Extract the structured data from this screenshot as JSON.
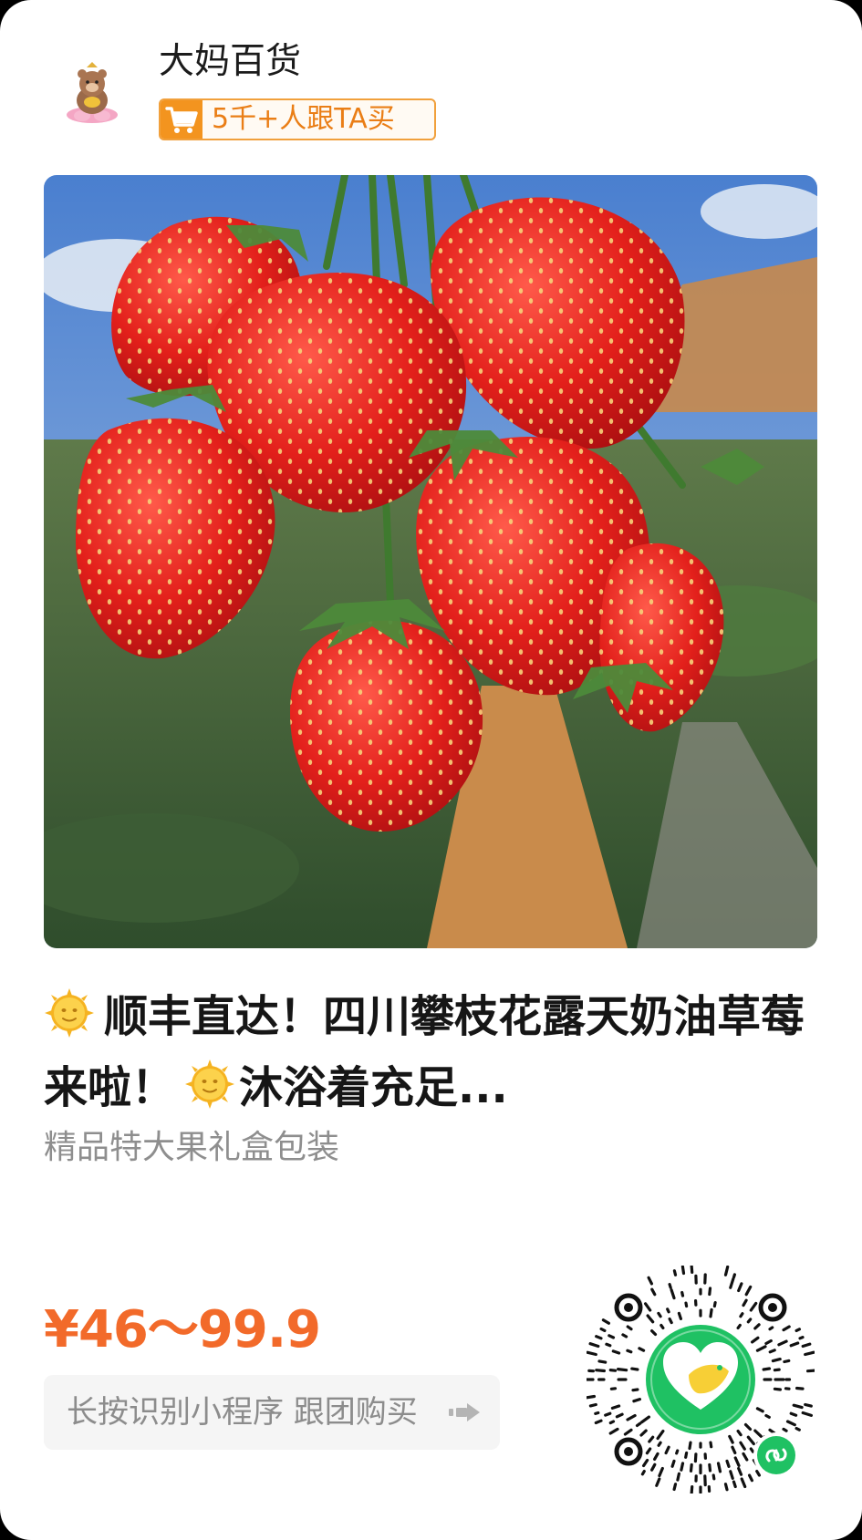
{
  "shop": {
    "name": "大妈百货",
    "followers_badge": "5千+人跟TA买"
  },
  "product": {
    "title_part1": "顺丰直达！四川攀枝花露天奶油草莓来啦！",
    "title_part2": "沐浴着充足...",
    "subtitle": "精品特大果礼盒包装",
    "price": "¥46～99.9"
  },
  "actions": {
    "scan_hint": "长按识别小程序 跟团购买"
  },
  "colors": {
    "accent_orange": "#f26a2a",
    "badge_orange": "#f3941f",
    "qr_green": "#1fc163"
  },
  "icons": {
    "avatar": "cartoon-bear-avatar-icon",
    "cart": "shopping-cart-icon",
    "sun": "sun-face-emoji-icon",
    "arrow": "forward-arrow-icon",
    "mini_program": "mini-program-icon"
  }
}
